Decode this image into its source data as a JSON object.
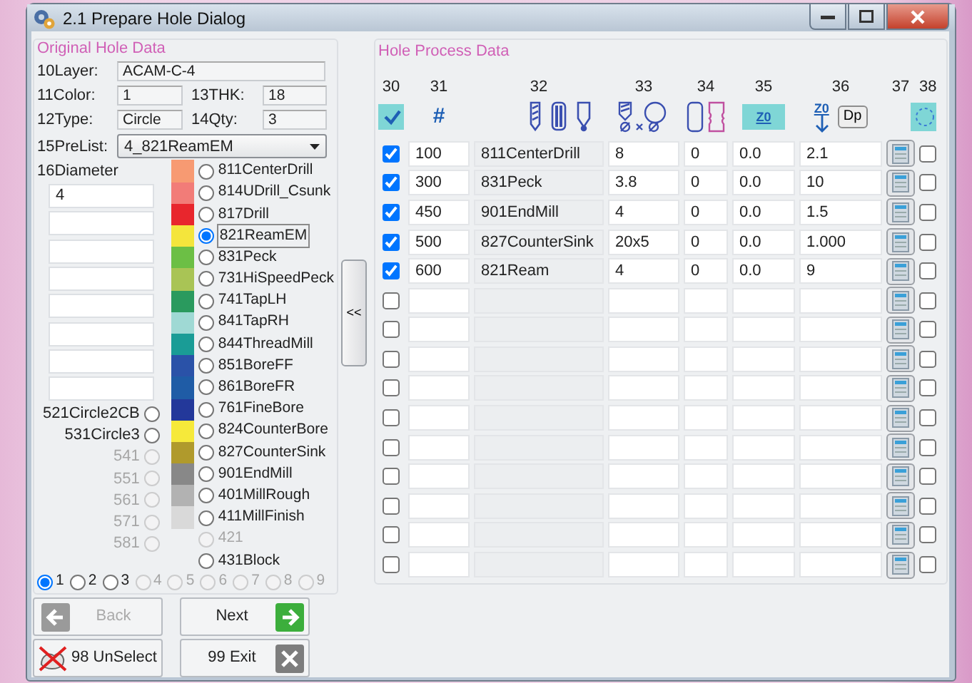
{
  "window": {
    "title": "2.1 Prepare Hole Dialog"
  },
  "original": {
    "title": "Original Hole Data",
    "layer": {
      "label": "10Layer:",
      "value": "ACAM-C-4"
    },
    "color": {
      "label": "11Color:",
      "value": "1"
    },
    "thk": {
      "label": "13THK:",
      "value": "18"
    },
    "type": {
      "label": "12Type:",
      "value": "Circle"
    },
    "qty": {
      "label": "14Qty:",
      "value": "3"
    },
    "prelist": {
      "label": "15PreList:",
      "value": "4_821ReamEM"
    },
    "diameter": {
      "label": "16Diameter",
      "value": "4"
    },
    "circles": [
      {
        "label": "521Circle2CB",
        "selected": false,
        "disabled": false
      },
      {
        "label": "531Circle3",
        "selected": false,
        "disabled": false
      },
      {
        "label": "541",
        "selected": false,
        "disabled": true
      },
      {
        "label": "551",
        "selected": false,
        "disabled": true
      },
      {
        "label": "561",
        "selected": false,
        "disabled": true
      },
      {
        "label": "571",
        "selected": false,
        "disabled": true
      },
      {
        "label": "581",
        "selected": false,
        "disabled": true
      }
    ],
    "tools": [
      {
        "label": "811CenterDrill",
        "color": "#f79a72",
        "selected": false,
        "disabled": false
      },
      {
        "label": "814UDrill_Csunk",
        "color": "#f27c78",
        "selected": false,
        "disabled": false
      },
      {
        "label": "817Drill",
        "color": "#e8262d",
        "selected": false,
        "disabled": false
      },
      {
        "label": "821ReamEM",
        "color": "#f4e53c",
        "selected": true,
        "disabled": false
      },
      {
        "label": "831Peck",
        "color": "#6cbf45",
        "selected": false,
        "disabled": false
      },
      {
        "label": "731HiSpeedPeck",
        "color": "#a9c455",
        "selected": false,
        "disabled": false
      },
      {
        "label": "741TapLH",
        "color": "#2a9a5e",
        "selected": false,
        "disabled": false
      },
      {
        "label": "841TapRH",
        "color": "#9fd9d4",
        "selected": false,
        "disabled": false
      },
      {
        "label": "844ThreadMill",
        "color": "#1a9c96",
        "selected": false,
        "disabled": false
      },
      {
        "label": "851BoreFF",
        "color": "#2a52a8",
        "selected": false,
        "disabled": false
      },
      {
        "label": "861BoreFR",
        "color": "#1f5ca6",
        "selected": false,
        "disabled": false
      },
      {
        "label": "761FineBore",
        "color": "#23389a",
        "selected": false,
        "disabled": false
      },
      {
        "label": "824CounterBore",
        "color": "#f6e93a",
        "selected": false,
        "disabled": false
      },
      {
        "label": "827CounterSink",
        "color": "#b09a2c",
        "selected": false,
        "disabled": false
      },
      {
        "label": "901EndMill",
        "color": "#888888",
        "selected": false,
        "disabled": false
      },
      {
        "label": "401MillRough",
        "color": "#b2b2b2",
        "selected": false,
        "disabled": false
      },
      {
        "label": "411MillFinish",
        "color": "#d9d9d9",
        "selected": false,
        "disabled": false
      },
      {
        "label": "421",
        "selected": false,
        "disabled": true
      },
      {
        "label": "431Block",
        "selected": false,
        "disabled": false
      }
    ],
    "pages": [
      {
        "label": "1",
        "selected": true,
        "disabled": false
      },
      {
        "label": "2",
        "selected": false,
        "disabled": false
      },
      {
        "label": "3",
        "selected": false,
        "disabled": false
      },
      {
        "label": "4",
        "selected": false,
        "disabled": true
      },
      {
        "label": "5",
        "selected": false,
        "disabled": true
      },
      {
        "label": "6",
        "selected": false,
        "disabled": true
      },
      {
        "label": "7",
        "selected": false,
        "disabled": true
      },
      {
        "label": "8",
        "selected": false,
        "disabled": true
      },
      {
        "label": "9",
        "selected": false,
        "disabled": true
      }
    ]
  },
  "buttons": [
    {
      "label": "Back",
      "kind": "back",
      "disabled": true
    },
    {
      "label": "Next",
      "kind": "next",
      "disabled": false
    },
    {
      "label": "98 UnSelect",
      "kind": "unselect",
      "disabled": false
    },
    {
      "label": "99 Exit",
      "kind": "exit",
      "disabled": false
    }
  ],
  "collapse_button": {
    "label": "<<"
  },
  "process": {
    "title": "Hole Process Data",
    "columns": [
      {
        "number": "30",
        "kind": "check"
      },
      {
        "number": "31",
        "kind": "hash",
        "symbol": "#"
      },
      {
        "number": "32",
        "kind": "tools"
      },
      {
        "number": "33",
        "kind": "diameter"
      },
      {
        "number": "34",
        "kind": "pair"
      },
      {
        "number": "35",
        "kind": "z0",
        "symbol": "Z0"
      },
      {
        "number": "36",
        "kind": "depth",
        "symbol": "Z0",
        "button": "Dp"
      },
      {
        "number": "37",
        "kind": "blank"
      },
      {
        "number": "38",
        "kind": "circle"
      }
    ],
    "rows": [
      {
        "checked": true,
        "seq": "100",
        "tool": "811CenterDrill",
        "col_33": "8",
        "col_34": "0",
        "col_35": "0.0",
        "col_36": "2.1",
        "flag": false
      },
      {
        "checked": true,
        "seq": "300",
        "tool": "831Peck",
        "col_33": "3.8",
        "col_34": "0",
        "col_35": "0.0",
        "col_36": "10",
        "flag": false
      },
      {
        "checked": true,
        "seq": "450",
        "tool": "901EndMill",
        "col_33": "4",
        "col_34": "0",
        "col_35": "0.0",
        "col_36": "1.5",
        "flag": false
      },
      {
        "checked": true,
        "seq": "500",
        "tool": "827CounterSink",
        "col_33": "20x5",
        "col_34": "0",
        "col_35": "0.0",
        "col_36": "1.000",
        "flag": false
      },
      {
        "checked": true,
        "seq": "600",
        "tool": "821Ream",
        "col_33": "4",
        "col_34": "0",
        "col_35": "0.0",
        "col_36": "9",
        "flag": false
      },
      {
        "checked": false,
        "flag": false
      },
      {
        "checked": false,
        "flag": false
      },
      {
        "checked": false,
        "flag": false
      },
      {
        "checked": false,
        "flag": false
      },
      {
        "checked": false,
        "flag": false
      },
      {
        "checked": false,
        "flag": false
      },
      {
        "checked": false,
        "flag": false
      },
      {
        "checked": false,
        "flag": false
      },
      {
        "checked": false,
        "flag": false
      },
      {
        "checked": false,
        "flag": false
      }
    ]
  }
}
